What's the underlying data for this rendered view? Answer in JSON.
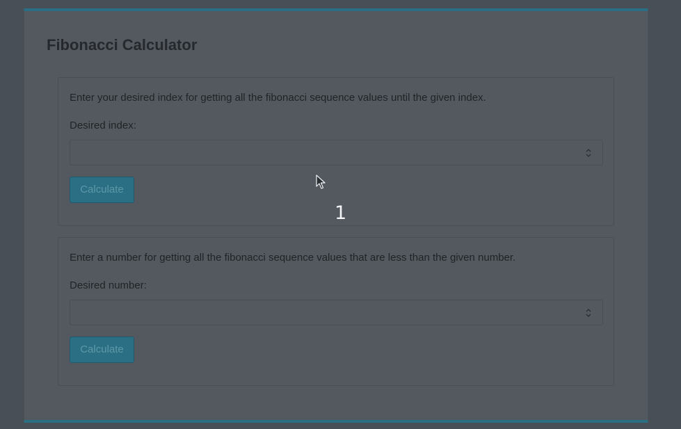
{
  "page": {
    "title": "Fibonacci Calculator"
  },
  "index_section": {
    "description": "Enter your desired index for getting all the fibonacci sequence values until the given index.",
    "label": "Desired index:",
    "input_value": "",
    "button_label": "Calculate"
  },
  "number_section": {
    "description": "Enter a number for getting all the fibonacci sequence values that are less than the given number.",
    "label": "Desired number:",
    "input_value": "",
    "button_label": "Calculate"
  },
  "overlay": {
    "step_number": "1"
  },
  "icons": {
    "spinner": "spinner-arrows-icon",
    "cursor": "mouse-pointer-icon"
  },
  "colors": {
    "accent": "#2b6f84",
    "background": "#494f56",
    "card": "#53595f"
  }
}
